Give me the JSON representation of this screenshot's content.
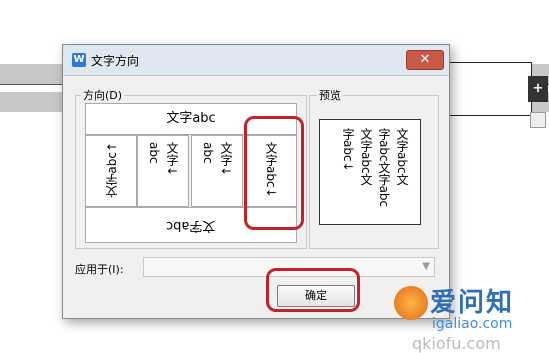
{
  "dialog": {
    "title": "文字方向",
    "close_label": "✕",
    "direction_group_label": "方向(D)",
    "preview_group_label": "预览",
    "direction_options": {
      "horizontal": "文字abc",
      "vertical_up": "文字abc↑",
      "vertical_stacked_1": "文字↓",
      "vertical_stacked_1b": "abc",
      "vertical_stacked_2": "文字↓",
      "vertical_stacked_2b": "abc",
      "vertical_down": "文字abc↓",
      "rotated": "文字abc"
    },
    "preview": {
      "col1": "文字abc文",
      "col2": "字abc文字abc",
      "col3": "文字abc文",
      "col4": "字abc↓"
    },
    "apply_label": "应用于(I):",
    "apply_value": "",
    "ok_label": "确定"
  },
  "colors": {
    "highlight": "#c2232b",
    "titlebar": "#dfe7f1",
    "dialog_bg": "#f0f0f0"
  },
  "watermark": {
    "brand": "爱问知",
    "url": "igaliao.com",
    "url2": "qkiofu.com"
  }
}
